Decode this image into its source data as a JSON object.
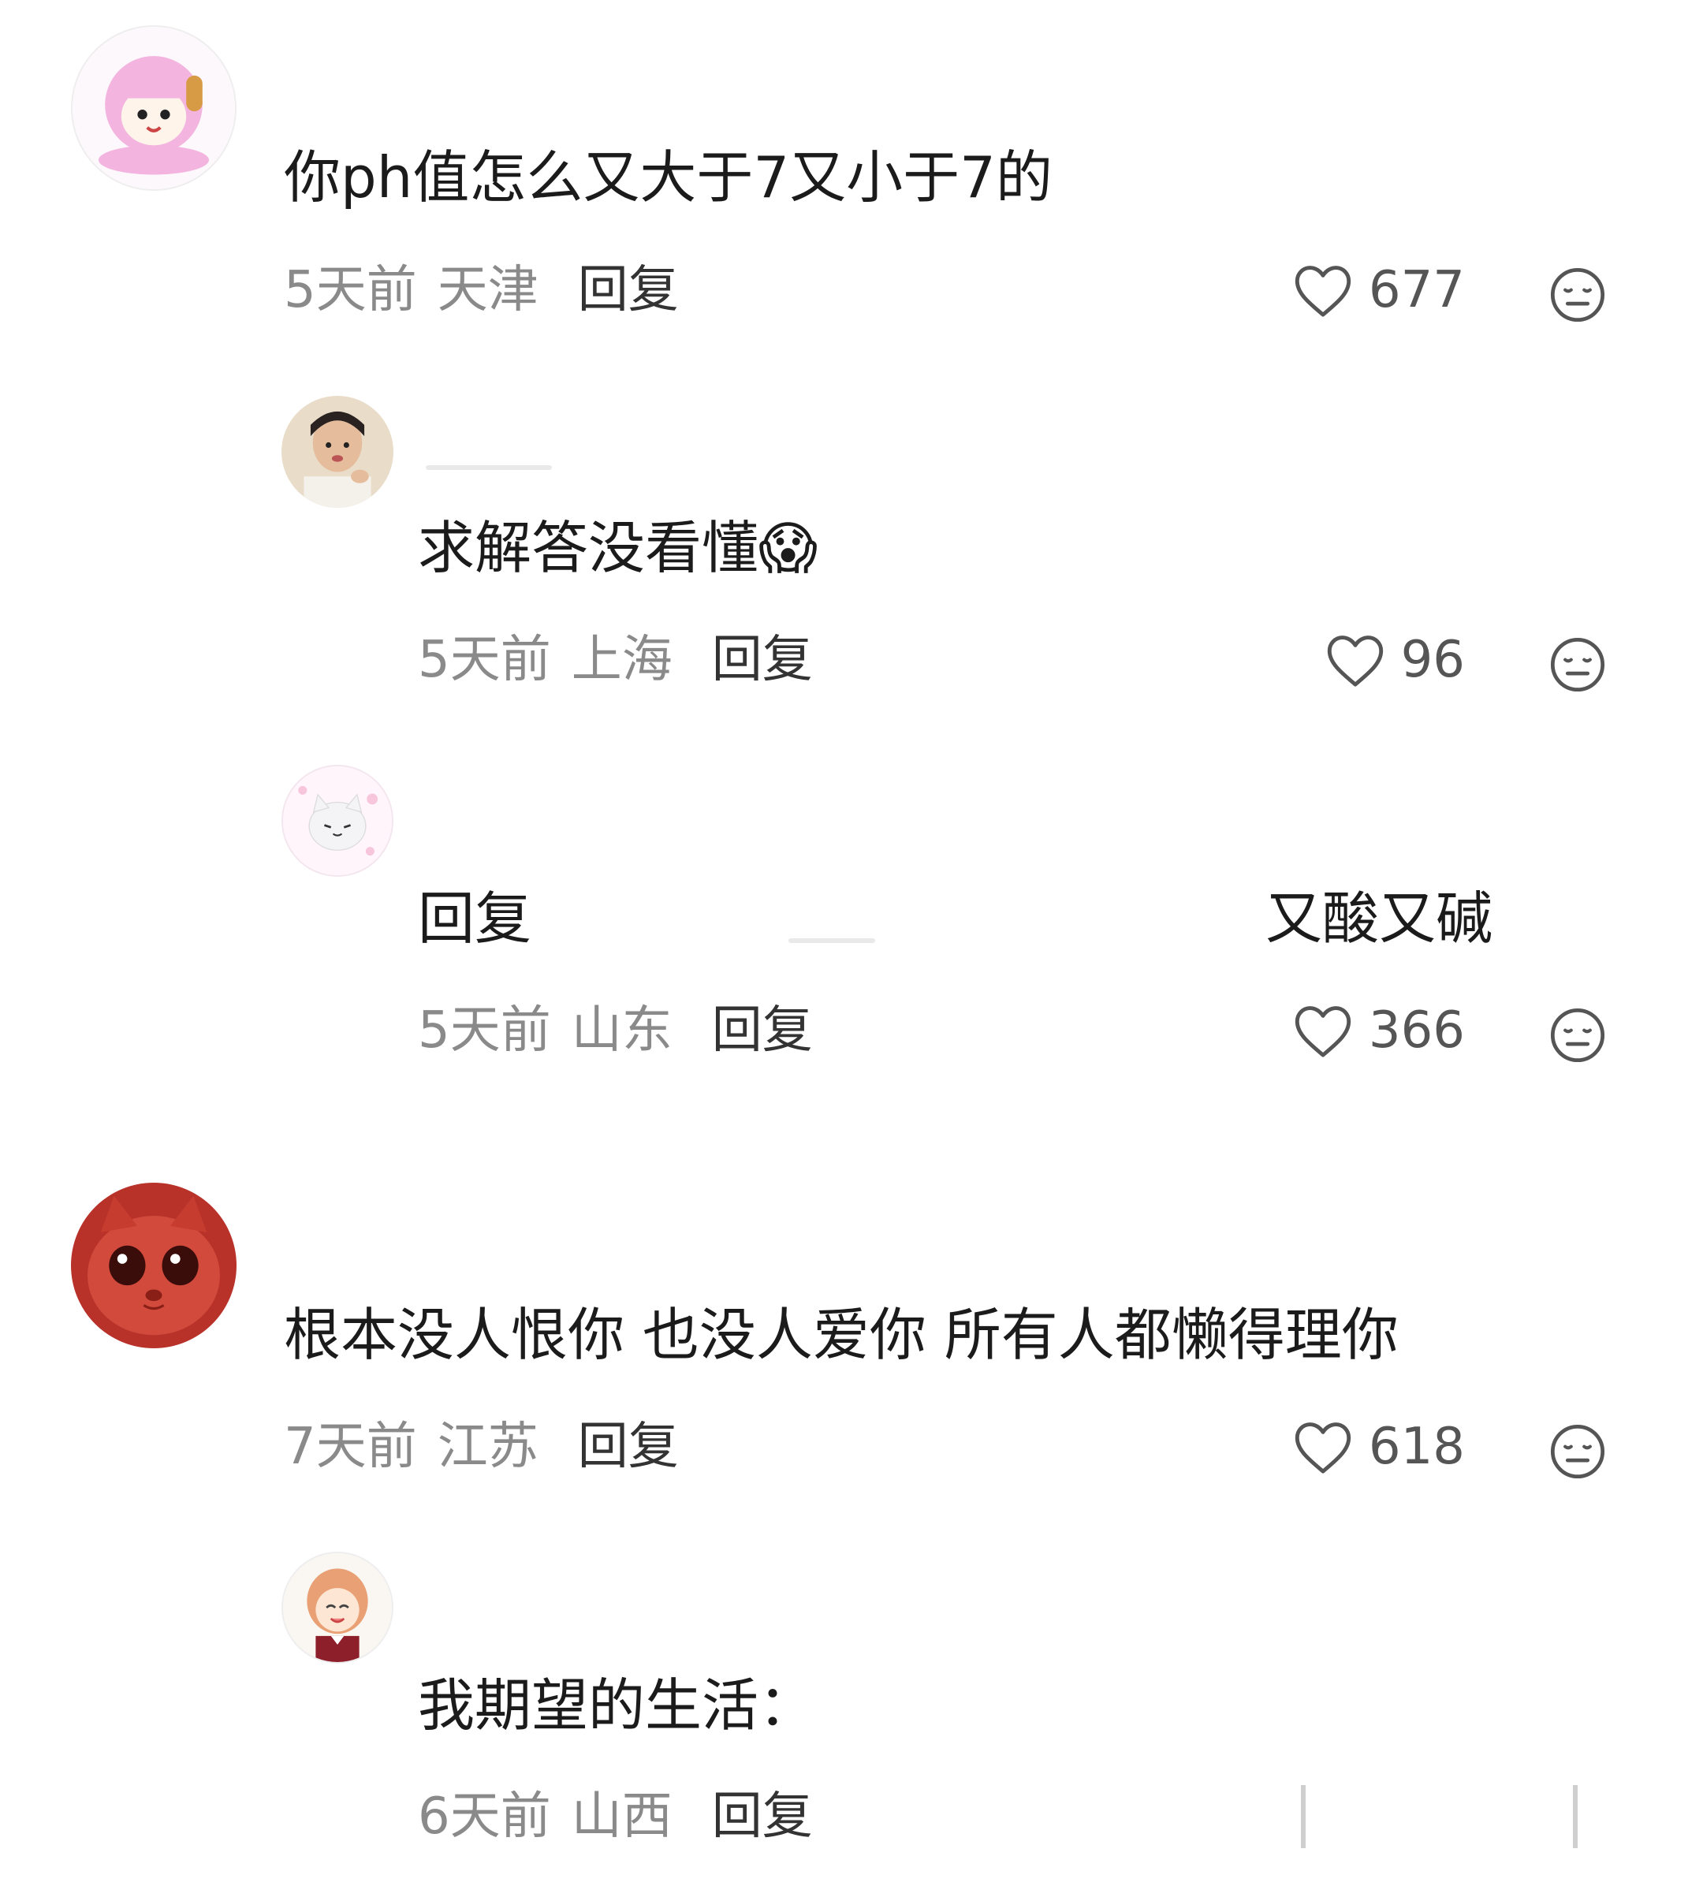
{
  "comments": [
    {
      "text": "你ph值怎么又大于7又小于7的",
      "time": "5天前",
      "location": "天津",
      "reply": "回复",
      "likes": "677",
      "avatar": "pink-hair-anime-avatar"
    },
    {
      "text": "求解答没看懂😱",
      "time": "5天前",
      "location": "上海",
      "reply": "回复",
      "likes": "96",
      "avatar": "young-man-photo-avatar"
    },
    {
      "text_left": "回复",
      "text_right": "又酸又碱",
      "time": "5天前",
      "location": "山东",
      "reply": "回复",
      "likes": "366",
      "avatar": "white-cat-cartoon-avatar"
    },
    {
      "text": "根本没人恨你 也没人爱你 所有人都懒得理你",
      "time": "7天前",
      "location": "江苏",
      "reply": "回复",
      "likes": "618",
      "avatar": "red-cat-photo-avatar"
    },
    {
      "text": "我期望的生活：",
      "time": "6天前",
      "location": "山西",
      "reply": "回复",
      "avatar": "anime-girl-avatar"
    }
  ],
  "colors": {
    "text": "#1b1b1b",
    "meta": "#8a8a8a",
    "reply": "#333333",
    "icon": "#555555"
  },
  "icons": {
    "like": "heart-outline-icon",
    "dislike": "neutral-face-icon"
  }
}
